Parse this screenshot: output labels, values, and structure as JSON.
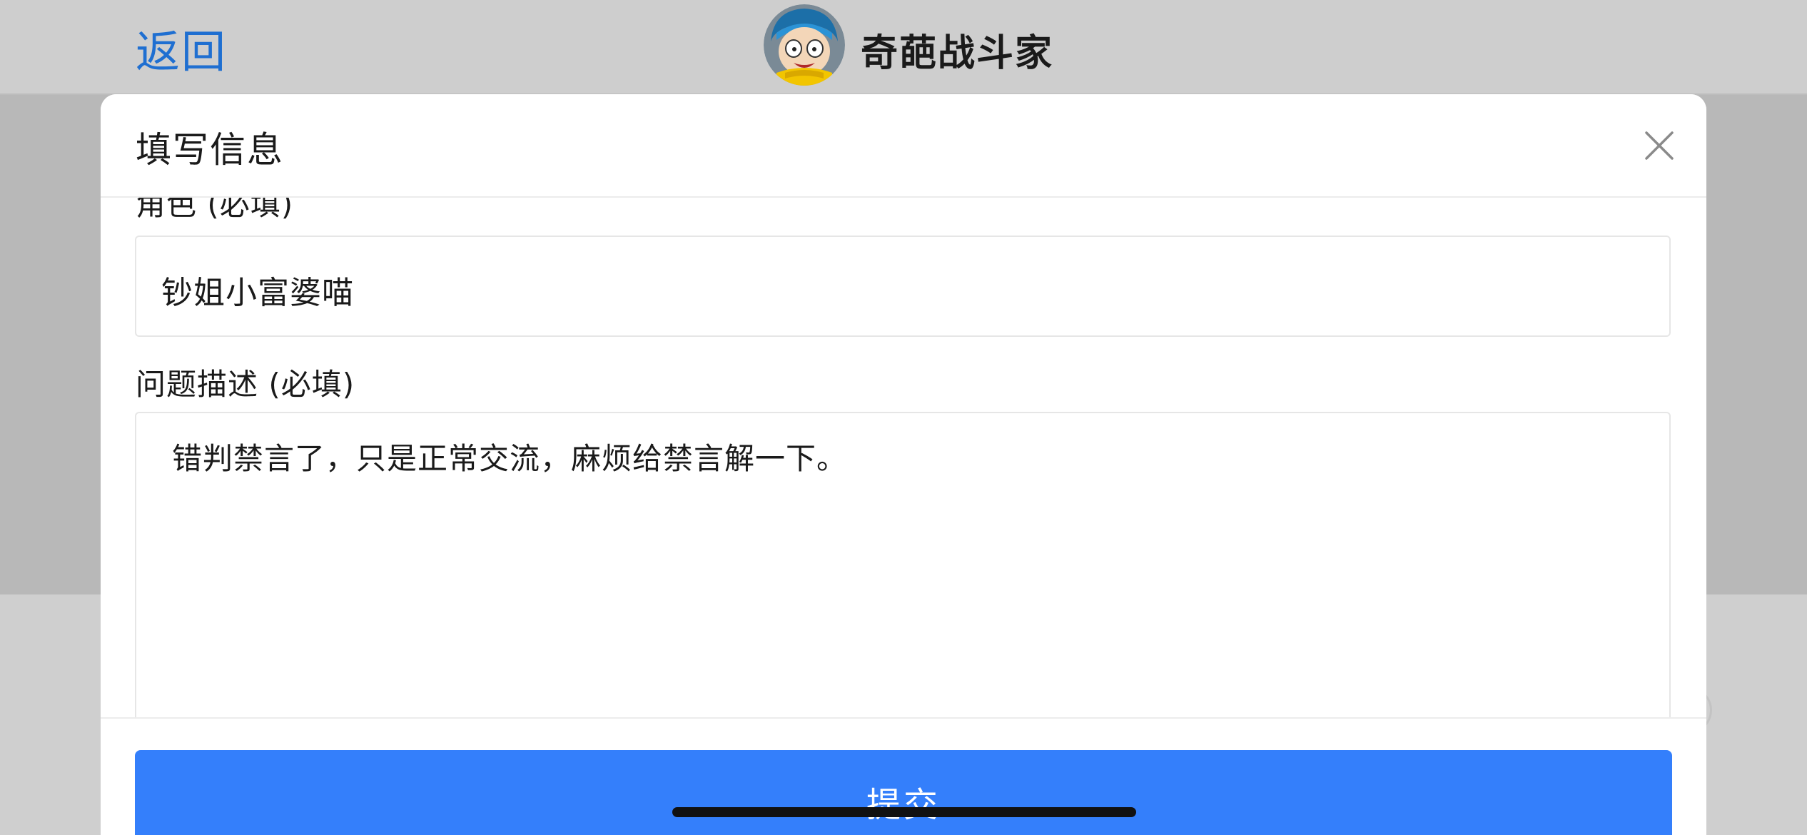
{
  "nav": {
    "back_label": "返回",
    "game_title": "奇葩战斗家",
    "avatar_icon": "game-character-avatar",
    "link_color": "#1f6fd1"
  },
  "modal": {
    "title": "填写信息",
    "close_icon": "close-icon",
    "fields": {
      "role": {
        "label": "角色 (必填)",
        "value": "钞姐小富婆喵"
      },
      "description": {
        "label": "问题描述 (必填)",
        "value": "错判禁言了，只是正常交流，麻烦给禁言解一下。"
      }
    },
    "submit_label": "提交",
    "submit_color": "#347ffb"
  }
}
